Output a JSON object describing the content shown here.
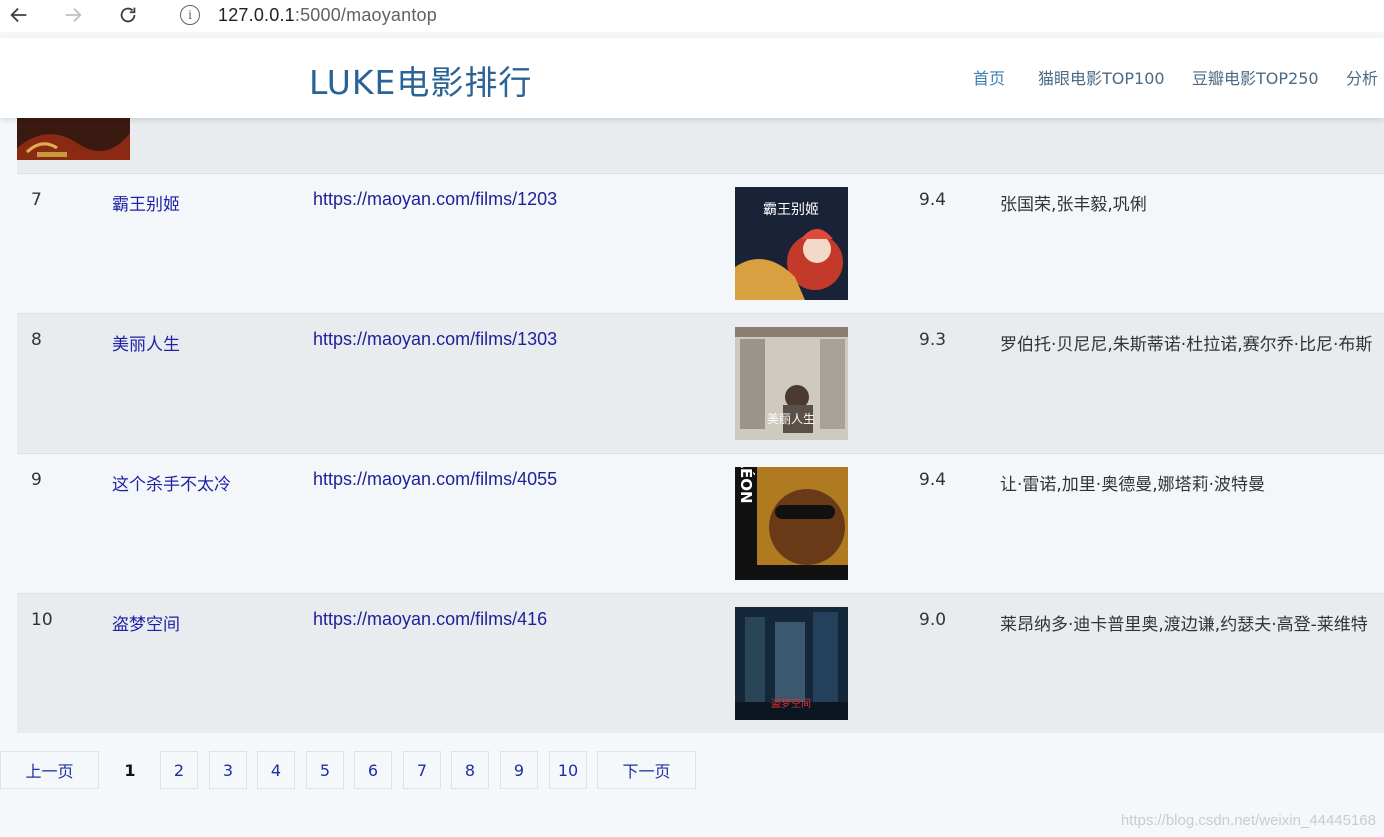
{
  "browser": {
    "url_host": "127.0.0.1",
    "url_rest": ":5000/maoyantop"
  },
  "header": {
    "brand": "LUKE电影排行",
    "nav": [
      "首页",
      "猫眼电影TOP100",
      "豆瓣电影TOP250",
      "分析"
    ]
  },
  "rows": [
    {
      "rank": "7",
      "name": "霸王别姬",
      "url": "https://maoyan.com/films/1203",
      "score": "9.4",
      "actors": "张国荣,张丰毅,巩俐",
      "poster_text": "霸王别姬"
    },
    {
      "rank": "8",
      "name": "美丽人生",
      "url": "https://maoyan.com/films/1303",
      "score": "9.3",
      "actors": "罗伯托·贝尼尼,朱斯蒂诺·杜拉诺,赛尔乔·比尼·布斯",
      "poster_text": "美丽人生"
    },
    {
      "rank": "9",
      "name": "这个杀手不太冷",
      "url": "https://maoyan.com/films/4055",
      "score": "9.4",
      "actors": "让·雷诺,加里·奥德曼,娜塔莉·波特曼",
      "poster_text": "LÉON"
    },
    {
      "rank": "10",
      "name": "盗梦空间",
      "url": "https://maoyan.com/films/416",
      "score": "9.0",
      "actors": "莱昂纳多·迪卡普里奥,渡边谦,约瑟夫·高登-莱维特",
      "poster_text": "盗梦空间"
    }
  ],
  "pagination": {
    "prev": "上一页",
    "next": "下一页",
    "pages": [
      "1",
      "2",
      "3",
      "4",
      "5",
      "6",
      "7",
      "8",
      "9",
      "10"
    ],
    "current": "1"
  },
  "watermark": "https://blog.csdn.net/weixin_44445168"
}
